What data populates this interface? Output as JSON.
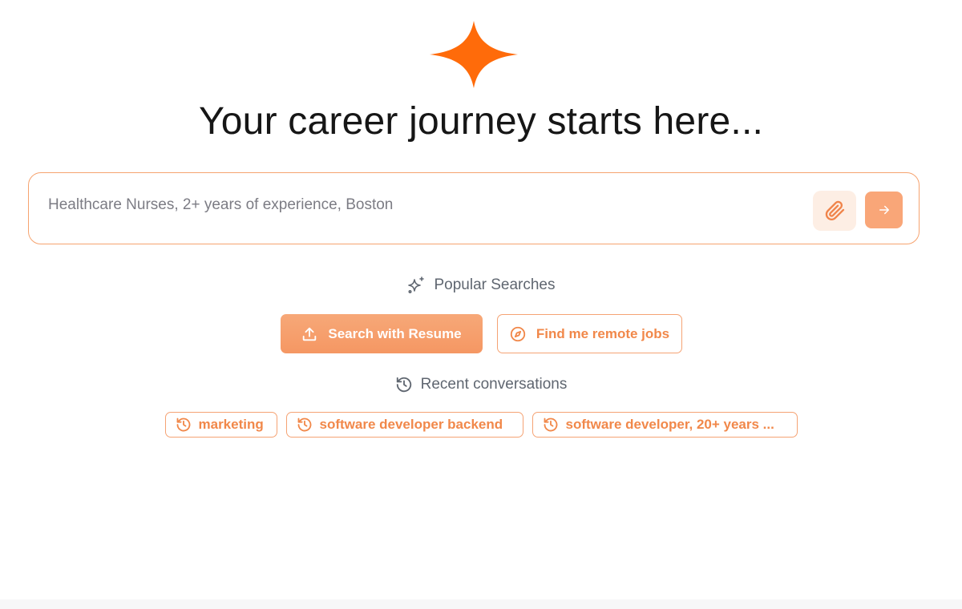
{
  "colors": {
    "accent": "#ff6b0a",
    "chip_text": "#f1884a",
    "chip_border": "#f5a374",
    "primary_chip_bg": "#f59763",
    "heading": "#161616",
    "muted": "#5f6670"
  },
  "logo": {
    "icon": "sparkle-star-icon"
  },
  "headline": "Your career journey starts here...",
  "search": {
    "placeholder": "Healthcare Nurses, 2+ years of experience, Boston",
    "value": "",
    "attach_icon": "paperclip-icon",
    "send_icon": "arrow-right-icon"
  },
  "popular": {
    "icon": "sparkles-icon",
    "label": "Popular Searches",
    "items": [
      {
        "label": "Search with Resume",
        "icon": "upload-icon"
      },
      {
        "label": "Find me remote jobs",
        "icon": "compass-icon"
      }
    ]
  },
  "recent": {
    "icon": "history-icon",
    "label": "Recent conversations",
    "items": [
      {
        "label": "marketing",
        "icon": "history-icon"
      },
      {
        "label": "software developer backend",
        "icon": "history-icon"
      },
      {
        "label": "software developer, 20+ years ...",
        "icon": "history-icon"
      }
    ]
  }
}
